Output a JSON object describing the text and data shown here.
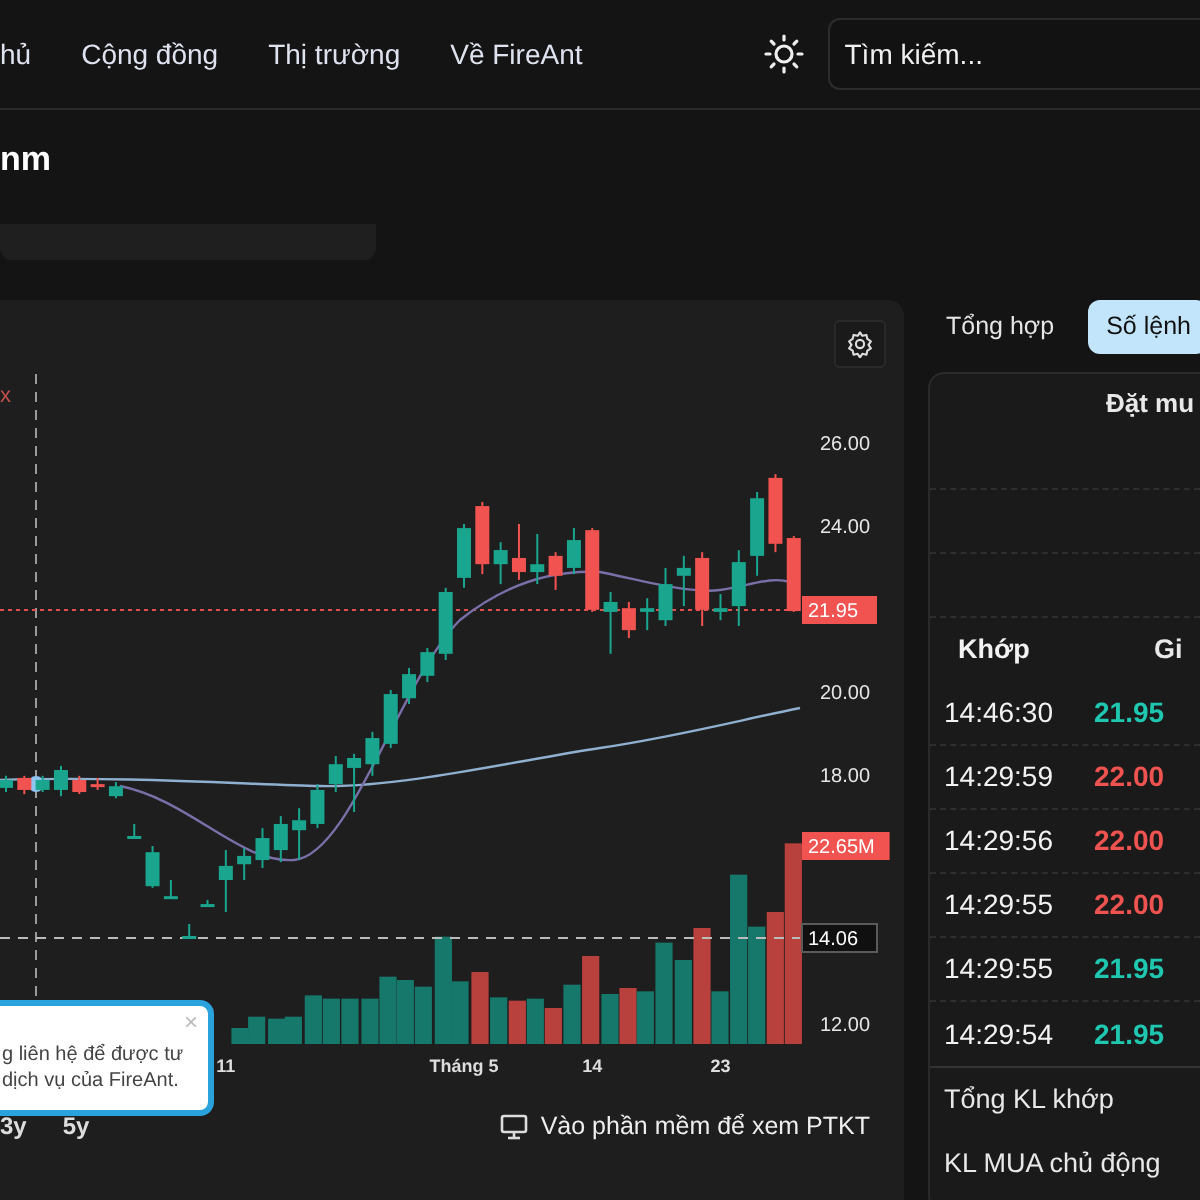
{
  "nav": {
    "items": [
      "hủ",
      "Cộng đồng",
      "Thị trường",
      "Về FireAnt"
    ],
    "search": {
      "placeholder": "Tìm kiếm..."
    }
  },
  "title": "nm",
  "chart": {
    "corner_mark": "x",
    "chart_data": {
      "type": "candlestick",
      "categories": [
        null,
        null,
        null,
        null,
        null,
        null,
        null,
        null,
        null,
        null,
        null,
        null,
        "11",
        null,
        null,
        null,
        null,
        null,
        null,
        null,
        null,
        null,
        null,
        null,
        null,
        "Tháng 5",
        null,
        null,
        null,
        null,
        null,
        null,
        "14",
        null,
        null,
        null,
        null,
        null,
        null,
        "23",
        null,
        null,
        null,
        null
      ],
      "ohlc": [
        [
          17.69,
          17.98,
          17.59,
          17.88
        ],
        [
          17.93,
          17.98,
          17.54,
          17.64
        ],
        [
          17.64,
          17.98,
          17.59,
          17.88
        ],
        [
          17.64,
          18.22,
          17.49,
          18.12
        ],
        [
          17.88,
          17.98,
          17.54,
          17.59
        ],
        [
          17.78,
          17.93,
          17.64,
          17.73
        ],
        [
          17.49,
          17.83,
          17.44,
          17.73
        ],
        [
          16.48,
          16.82,
          16.48,
          16.53
        ],
        [
          15.32,
          16.29,
          15.28,
          16.14
        ],
        [
          15.03,
          15.47,
          15.03,
          15.08
        ],
        [
          14.07,
          14.41,
          14.07,
          14.12
        ],
        [
          14.84,
          14.99,
          14.84,
          14.89
        ],
        [
          15.47,
          16.19,
          14.7,
          15.81
        ],
        [
          15.85,
          16.24,
          15.47,
          16.05
        ],
        [
          15.95,
          16.72,
          15.76,
          16.48
        ],
        [
          16.19,
          17.01,
          15.9,
          16.82
        ],
        [
          16.67,
          17.2,
          15.95,
          16.91
        ],
        [
          16.82,
          17.78,
          16.72,
          17.64
        ],
        [
          17.78,
          18.46,
          17.59,
          18.26
        ],
        [
          18.17,
          18.51,
          17.11,
          18.41
        ],
        [
          18.26,
          19.04,
          17.98,
          18.89
        ],
        [
          18.75,
          20.05,
          18.65,
          19.95
        ],
        [
          19.85,
          20.58,
          19.71,
          20.43
        ],
        [
          20.39,
          21.06,
          20.24,
          20.96
        ],
        [
          20.92,
          22.51,
          20.77,
          22.41
        ],
        [
          22.75,
          24.05,
          22.51,
          23.95
        ],
        [
          24.48,
          24.58,
          22.84,
          23.08
        ],
        [
          23.08,
          23.61,
          22.6,
          23.42
        ],
        [
          23.23,
          24.05,
          22.7,
          22.89
        ],
        [
          22.89,
          23.81,
          22.6,
          23.08
        ],
        [
          23.28,
          23.37,
          22.46,
          22.8
        ],
        [
          22.99,
          23.95,
          22.84,
          23.66
        ],
        [
          23.9,
          23.95,
          21.93,
          21.98
        ],
        [
          21.93,
          22.41,
          20.92,
          22.17
        ],
        [
          22.02,
          22.17,
          21.3,
          21.49
        ],
        [
          21.93,
          22.26,
          21.49,
          22.02
        ],
        [
          21.73,
          22.99,
          21.59,
          22.6
        ],
        [
          22.8,
          23.28,
          22.07,
          22.99
        ],
        [
          23.23,
          23.37,
          21.59,
          21.98
        ],
        [
          21.93,
          22.36,
          21.73,
          22.02
        ],
        [
          22.07,
          23.42,
          21.59,
          23.13
        ],
        [
          23.28,
          24.82,
          22.8,
          24.67
        ],
        [
          25.16,
          25.25,
          23.37,
          23.57
        ],
        [
          23.71,
          23.76,
          21.93,
          21.95
        ]
      ],
      "ylim": [
        12,
        26
      ],
      "yticks": [
        {
          "value": 26,
          "label": "26.00"
        },
        {
          "value": 24,
          "label": "24.00"
        },
        {
          "value": 20,
          "label": "20.00"
        },
        {
          "value": 18,
          "label": "18.00"
        },
        {
          "value": 12,
          "label": "12.00"
        }
      ]
    },
    "badges": [
      {
        "text": "21.95",
        "kind": "last-price"
      },
      {
        "text": "22.65M",
        "kind": "volume"
      },
      {
        "text": "14.06",
        "kind": "crosshair"
      }
    ],
    "ranges": [
      "3y",
      "5y"
    ],
    "link": "Vào phần mềm để xem PTKT"
  },
  "popup": {
    "lines": [
      "g liên hệ để được tư",
      "dịch vụ của FireAnt."
    ],
    "close": "×"
  },
  "side": {
    "tabs": [
      {
        "label": "Tổng hợp",
        "selected": false
      },
      {
        "label": "Số lệnh",
        "selected": true
      }
    ],
    "book_title": "Đặt mu",
    "match_columns": [
      "Khớp",
      "Gi"
    ],
    "matches": [
      {
        "time": "14:46:30",
        "price": "21.95",
        "color": "#1fc7b0"
      },
      {
        "time": "14:29:59",
        "price": "22.00",
        "color": "#ef5350"
      },
      {
        "time": "14:29:56",
        "price": "22.00",
        "color": "#ef5350"
      },
      {
        "time": "14:29:55",
        "price": "22.00",
        "color": "#ef5350"
      },
      {
        "time": "14:29:55",
        "price": "21.95",
        "color": "#1fc7b0"
      },
      {
        "time": "14:29:54",
        "price": "21.95",
        "color": "#1fc7b0"
      }
    ],
    "summary": [
      "Tổng KL khớp",
      "KL MUA chủ động"
    ]
  }
}
